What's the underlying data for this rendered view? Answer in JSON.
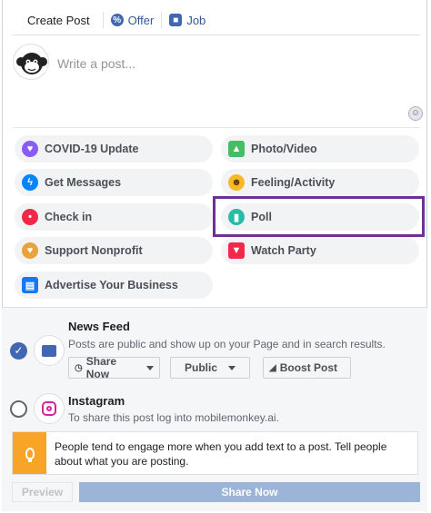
{
  "tabs": [
    {
      "label": "Create Post",
      "icon": "none"
    },
    {
      "label": "Offer",
      "icon": "percent-icon"
    },
    {
      "label": "Job",
      "icon": "briefcase-icon"
    }
  ],
  "composer": {
    "placeholder": "Write a post..."
  },
  "actions": [
    {
      "label": "COVID-19 Update",
      "icon": "heart-icon",
      "color": "#8a5cf6"
    },
    {
      "label": "Photo/Video",
      "icon": "photo-icon",
      "color": "#45bd62"
    },
    {
      "label": "Get Messages",
      "icon": "messenger-icon",
      "color": "#0084ff"
    },
    {
      "label": "Feeling/Activity",
      "icon": "smiley-icon",
      "color": "#f7b928"
    },
    {
      "label": "Check in",
      "icon": "location-pin-icon",
      "color": "#f02849"
    },
    {
      "label": "Poll",
      "icon": "poll-icon",
      "color": "#2abba7"
    },
    {
      "label": "Support Nonprofit",
      "icon": "nonprofit-icon",
      "color": "#e8a33c"
    },
    {
      "label": "Watch Party",
      "icon": "popcorn-icon",
      "color": "#f02849"
    },
    {
      "label": "Advertise Your Business",
      "icon": "advertise-icon",
      "color": "#1877f2"
    }
  ],
  "news_feed": {
    "title": "News Feed",
    "description": "Posts are public and show up on your Page and in search results.",
    "share_now": "Share Now",
    "audience": "Public",
    "boost": "Boost Post"
  },
  "instagram": {
    "title": "Instagram",
    "description": "To share this post log into mobilemonkey.ai."
  },
  "tip": {
    "text": "People tend to engage more when you add text to a post. Tell people about what you are posting."
  },
  "footer": {
    "preview": "Preview",
    "share_now": "Share Now"
  },
  "colors": {
    "accent": "#4267b2",
    "highlight": "#6e3191",
    "tip": "#f7a427"
  }
}
